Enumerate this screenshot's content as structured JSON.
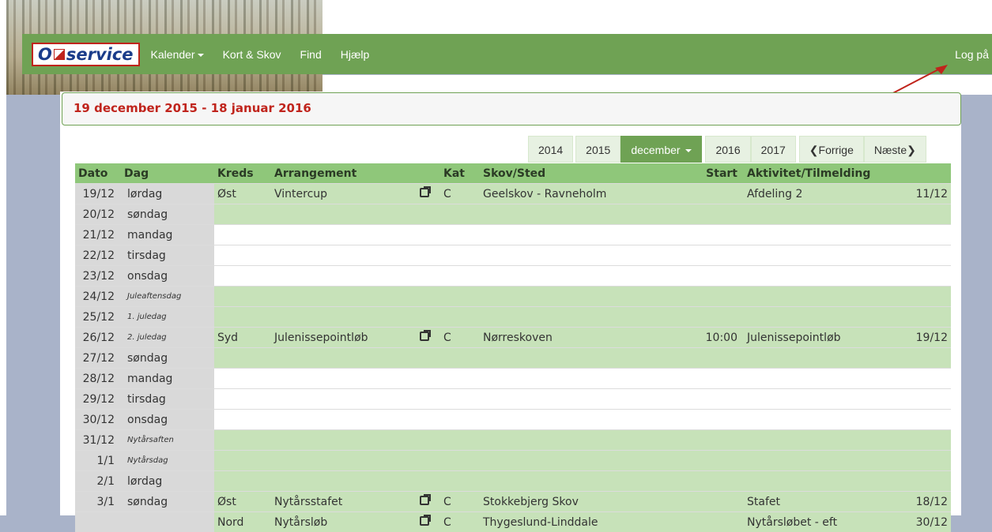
{
  "nav": {
    "logo_text": "O",
    "logo_text2": "service",
    "items": [
      "Kalender",
      "Kort & Skov",
      "Find",
      "Hjælp"
    ],
    "login": "Log på"
  },
  "period_title": "19 december 2015 - 18 januar 2016",
  "buttons": {
    "y2014": "2014",
    "y2015": "2015",
    "month": "december",
    "y2016": "2016",
    "y2017": "2017",
    "prev": "Forrige",
    "next": "Næste"
  },
  "table": {
    "headers": [
      "Dato",
      "Dag",
      "Kreds",
      "Arrangement",
      "",
      "Kat",
      "Skov/Sted",
      "Start",
      "Aktivitet/Tilmelding",
      ""
    ],
    "rows": [
      {
        "dato": "19/12",
        "dag": "lørdag",
        "kreds": "Øst",
        "arr": "Vintercup",
        "icon": true,
        "kat": "C",
        "skov": "Geelskov - Ravneholm",
        "start": "",
        "akt": "Afdeling 2",
        "last": "11/12",
        "style": "g"
      },
      {
        "dato": "20/12",
        "dag": "søndag",
        "style": "g"
      },
      {
        "dato": "21/12",
        "dag": "mandag",
        "style": "w"
      },
      {
        "dato": "22/12",
        "dag": "tirsdag",
        "style": "w"
      },
      {
        "dato": "23/12",
        "dag": "onsdag",
        "style": "w"
      },
      {
        "dato": "24/12",
        "dag": "Juleaftensdag",
        "small": true,
        "style": "g"
      },
      {
        "dato": "25/12",
        "dag": "1. juledag",
        "small": true,
        "style": "g"
      },
      {
        "dato": "26/12",
        "dag": "2. juledag",
        "small": true,
        "kreds": "Syd",
        "arr": "Julenissepointløb",
        "icon": true,
        "kat": "C",
        "skov": "Nørreskoven",
        "start": "10:00",
        "akt": "Julenissepointløb",
        "last": "19/12",
        "style": "g"
      },
      {
        "dato": "27/12",
        "dag": "søndag",
        "style": "g"
      },
      {
        "dato": "28/12",
        "dag": "mandag",
        "style": "w"
      },
      {
        "dato": "29/12",
        "dag": "tirsdag",
        "style": "w"
      },
      {
        "dato": "30/12",
        "dag": "onsdag",
        "style": "w"
      },
      {
        "dato": "31/12",
        "dag": "Nytårsaften",
        "small": true,
        "style": "g"
      },
      {
        "dato": "1/1",
        "dag": "Nytårsdag",
        "small": true,
        "style": "g"
      },
      {
        "dato": "2/1",
        "dag": "lørdag",
        "style": "g"
      },
      {
        "dato": "3/1",
        "dag": "søndag",
        "kreds": "Øst",
        "arr": "Nytårsstafet",
        "icon": true,
        "kat": "C",
        "skov": "Stokkebjerg Skov",
        "start": "",
        "akt": "Stafet",
        "last": "18/12",
        "style": "g"
      },
      {
        "dato": "",
        "dag": "",
        "kreds": "Nord",
        "arr": "Nytårsløb",
        "icon": true,
        "kat": "C",
        "skov": "Thygeslund-Linddale",
        "start": "",
        "akt": "Nytårsløbet - eft",
        "last": "30/12",
        "style": "g"
      }
    ]
  },
  "colors": {
    "green": "#6fa254",
    "light_green": "#c7e2b9",
    "header_green": "#8fc77a",
    "red": "#c0241c"
  }
}
